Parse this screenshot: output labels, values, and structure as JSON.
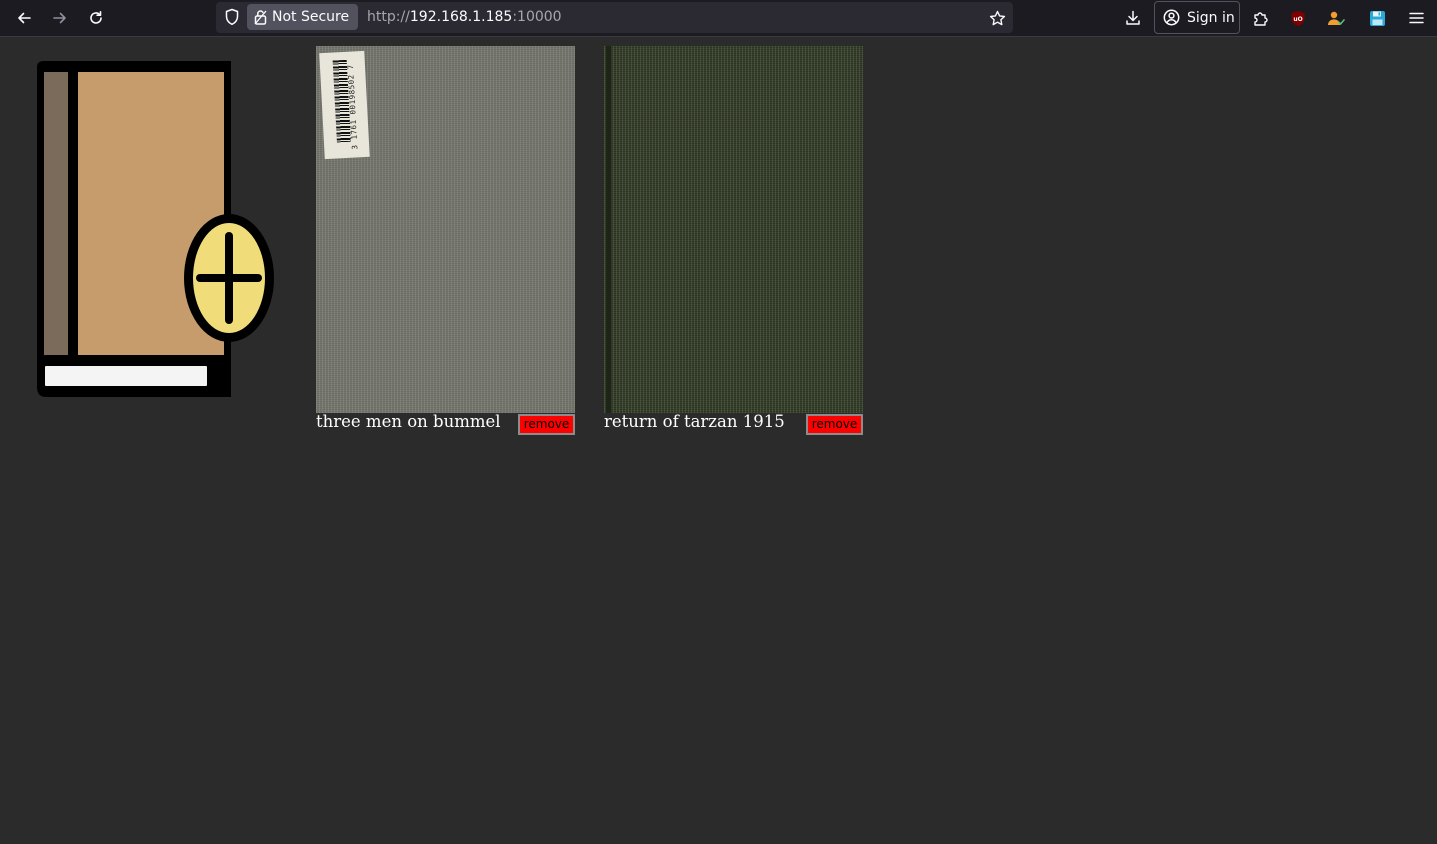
{
  "browser": {
    "security_label": "Not Secure",
    "url_scheme": "http://",
    "url_host": "192.168.1.185",
    "url_port": ":10000",
    "sign_in_label": "Sign in"
  },
  "colors": {
    "page_background": "#2b2b2b",
    "remove_button": "#ff0000",
    "add_book_cover": "#c69c6d",
    "add_book_spine": "#7b6b5b",
    "add_book_plus_badge": "#f0dc78"
  },
  "add_book": {
    "icon": "add-book-icon"
  },
  "books": [
    {
      "title": "three men on bummel",
      "remove_label": "remove",
      "cover_label_digits": "3 1761 00198502 7"
    },
    {
      "title": "return of tarzan 1915",
      "remove_label": "remove"
    }
  ]
}
